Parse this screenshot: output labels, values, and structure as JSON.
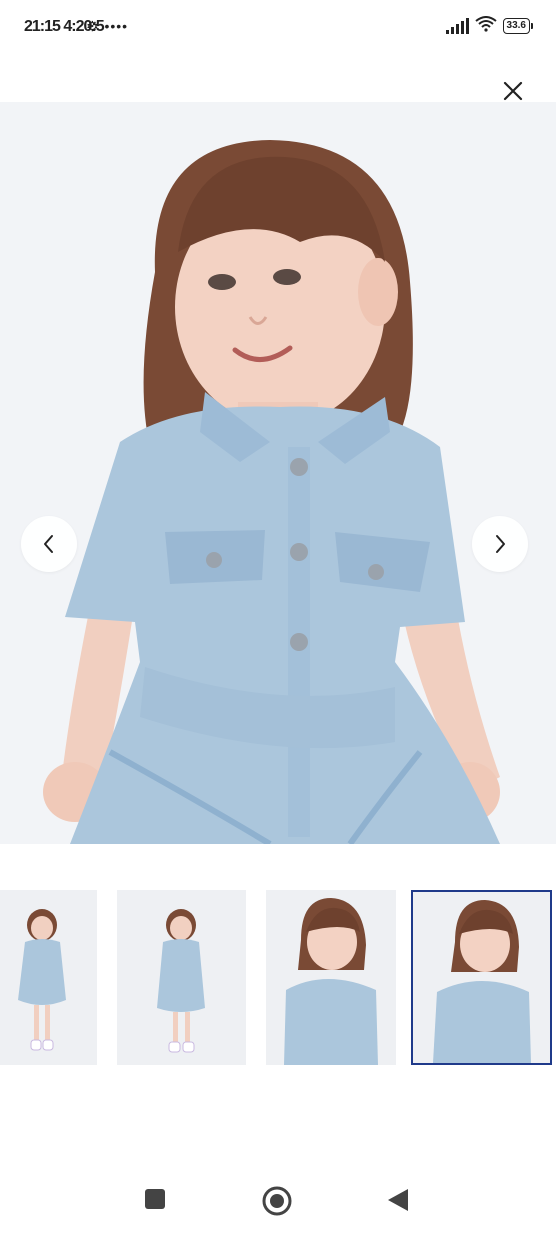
{
  "status_bar": {
    "time": "21:15 4:20:5",
    "left_icons": "⚙ ••••",
    "battery": "33.6"
  },
  "gallery": {
    "close_icon": "close-icon",
    "prev_icon": "chevron-left-icon",
    "next_icon": "chevron-right-icon",
    "thumbnail_count": 4,
    "selected_index": 3,
    "accent_color": "#1f3a8a"
  },
  "system_nav": {
    "recents_icon": "square-icon",
    "home_icon": "circle-icon",
    "back_icon": "triangle-back-icon"
  }
}
